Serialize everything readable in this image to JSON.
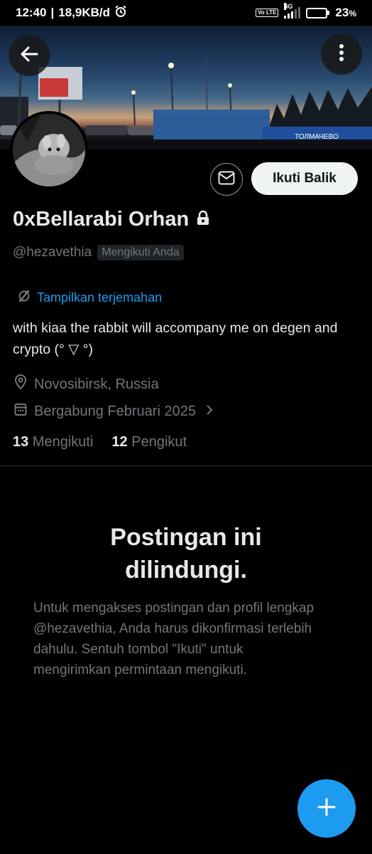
{
  "status_bar": {
    "time": "12:40",
    "network_speed": "18,9KB/d",
    "volte": "Vo LTE",
    "network_type": "4G",
    "battery": "23",
    "battery_unit": "%",
    "battery_level": 0.23
  },
  "header": {
    "back_icon": "arrow-left-icon",
    "more_icon": "more-vertical-icon"
  },
  "banner": {
    "sign_text": "ТОЛМАЧЕВО"
  },
  "profile": {
    "display_name": "0xBellarabi Orhan",
    "protected_icon": "lock-icon",
    "handle": "@hezavethia",
    "follows_you_badge": "Mengikuti Anda",
    "translate_link": "Tampilkan terjemahan",
    "bio": "with kiaa the rabbit will accompany me on degen and crypto (° ▽ °)",
    "location": "Novosibirsk, Russia",
    "joined": "Bergabung Februari 2025",
    "following_count": "13",
    "following_label": "Mengikuti",
    "followers_count": "12",
    "followers_label": "Pengikut"
  },
  "actions": {
    "message_icon": "mail-icon",
    "follow_back_label": "Ikuti Balik",
    "compose_icon": "plus-icon"
  },
  "protected_notice": {
    "title": "Postingan ini dilindungi.",
    "body": "Untuk mengakses postingan dan profil lengkap @hezavethia, Anda harus dikonfirmasi terlebih dahulu. Sentuh tombol \"Ikuti\" untuk mengirimkan permintaan mengikuti."
  },
  "colors": {
    "accent": "#1d9bf0",
    "background": "#000000",
    "primary_text": "#e7e9ea",
    "secondary_text": "#71767b"
  }
}
